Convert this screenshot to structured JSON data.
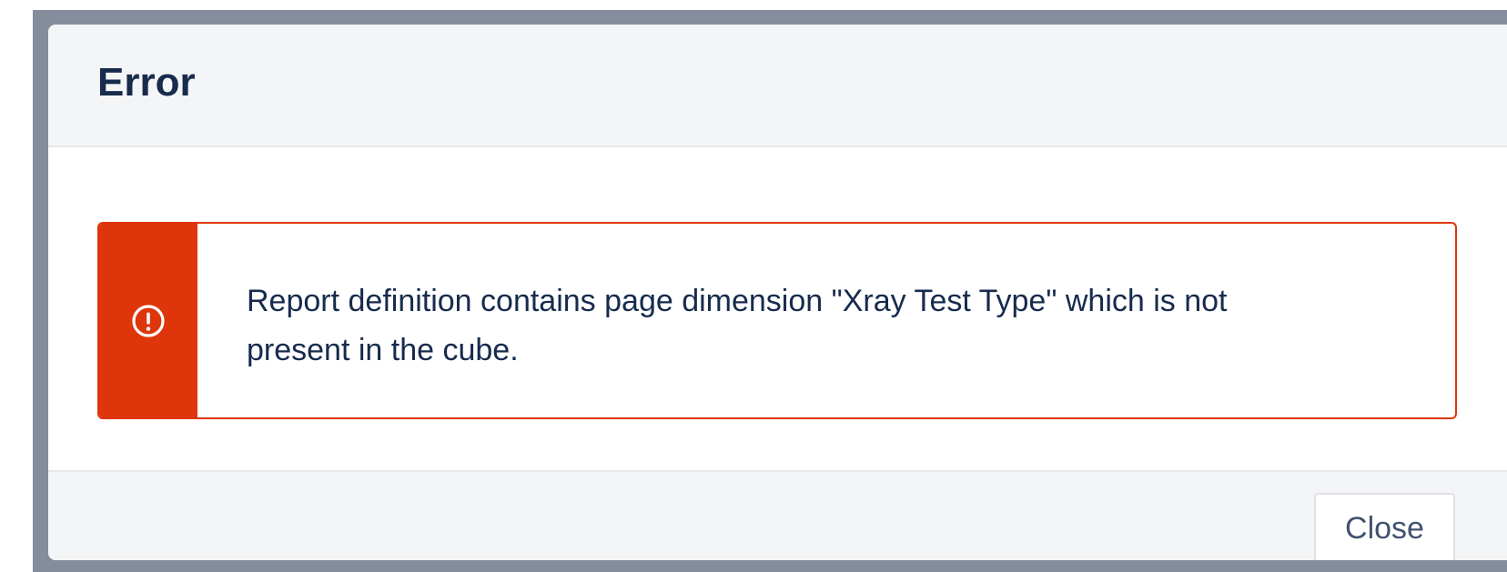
{
  "dialog": {
    "title": "Error",
    "error": {
      "icon": "exclamation-circle-icon",
      "message": "Report definition contains page dimension \"Xray Test Type\" which is not present in the cube."
    },
    "footer": {
      "close_label": "Close"
    }
  },
  "colors": {
    "error": "#de350b",
    "text": "#172b4d",
    "header_bg": "#f4f5f7",
    "backdrop": "#858d9c"
  }
}
